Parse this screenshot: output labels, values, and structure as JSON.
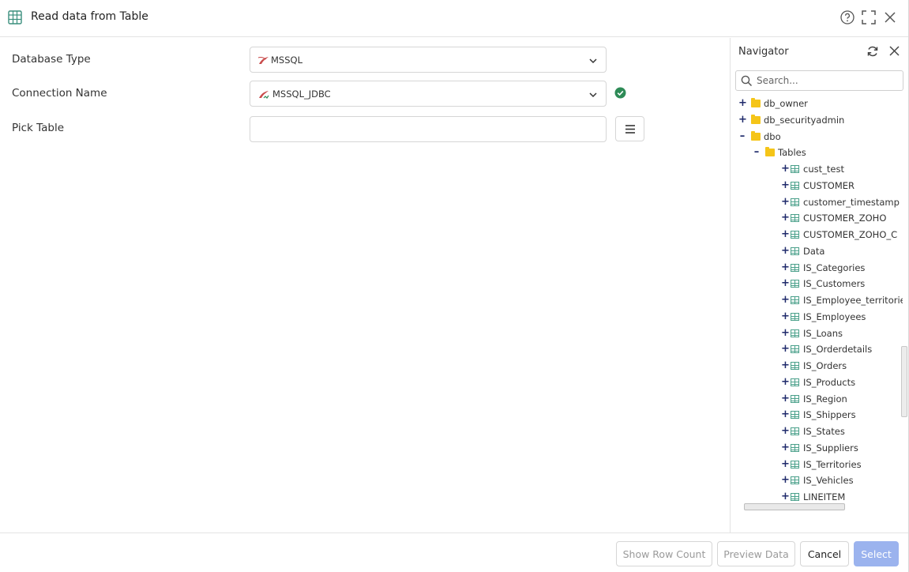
{
  "dialog": {
    "title": "Read data from Table"
  },
  "form": {
    "database_type": {
      "label": "Database Type",
      "value": "MSSQL"
    },
    "connection_name": {
      "label": "Connection Name",
      "value": "MSSQL_JDBC"
    },
    "pick_table": {
      "label": "Pick Table",
      "value": ""
    }
  },
  "navigator": {
    "title": "Navigator",
    "search_placeholder": "Search...",
    "tree": {
      "roots": [
        {
          "label": "db_owner",
          "expander": "+"
        },
        {
          "label": "db_securityadmin",
          "expander": "+"
        },
        {
          "label": "dbo",
          "expander": "–"
        }
      ],
      "tables_folder": {
        "label": "Tables",
        "expander": "–"
      },
      "tables": [
        "cust_test",
        "CUSTOMER",
        "customer_timestamp",
        "CUSTOMER_ZOHO",
        "CUSTOMER_ZOHO_C",
        "Data",
        "IS_Categories",
        "IS_Customers",
        "IS_Employee_territorie",
        "IS_Employees",
        "IS_Loans",
        "IS_Orderdetails",
        "IS_Orders",
        "IS_Products",
        "IS_Region",
        "IS_Shippers",
        "IS_States",
        "IS_Suppliers",
        "IS_Territories",
        "IS_Vehicles",
        "LINEITEM"
      ]
    }
  },
  "footer": {
    "show_row_count": "Show Row Count",
    "preview_data": "Preview Data",
    "cancel": "Cancel",
    "select": "Select"
  },
  "colors": {
    "accent": "#9bb3ee",
    "success": "#2e8b57",
    "folder": "#f5c518",
    "table_icon": "#4aa08a"
  }
}
